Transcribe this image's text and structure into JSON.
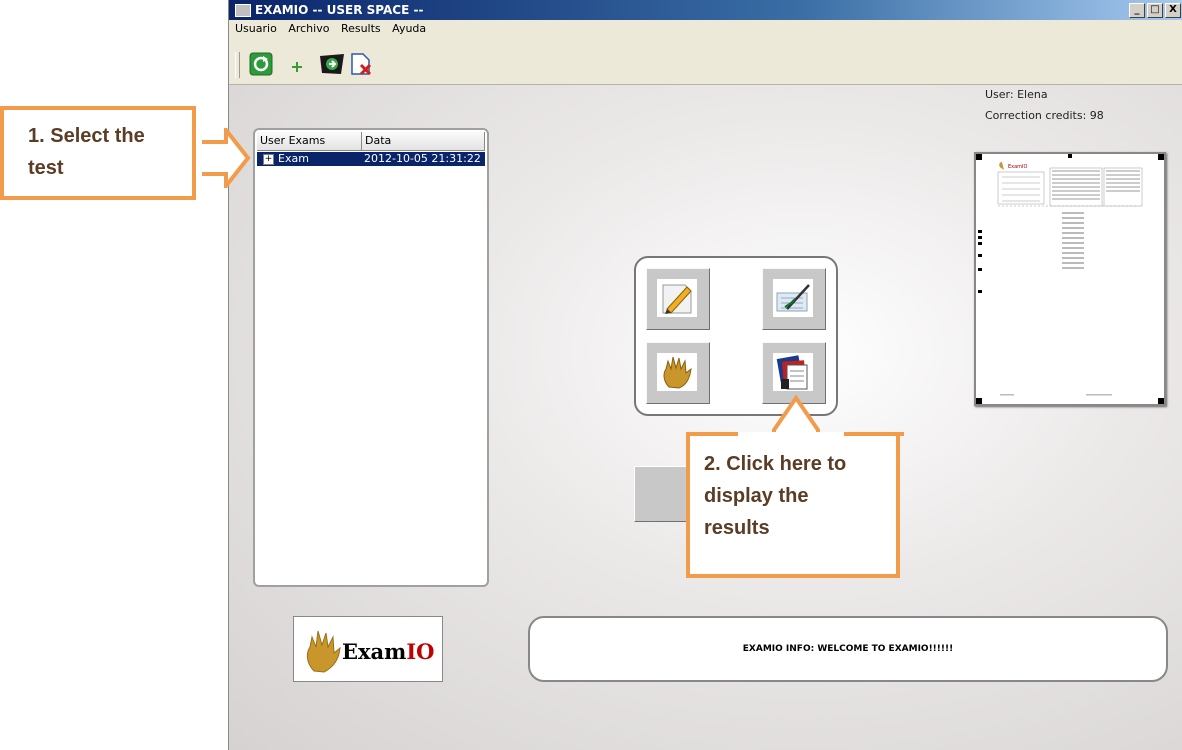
{
  "window": {
    "title": "EXAMIO -- USER SPACE --",
    "controls": [
      "_",
      "□",
      "X"
    ]
  },
  "menu": [
    "Usuario",
    "Archivo",
    "Results",
    "Ayuda"
  ],
  "toolbar": {
    "icons": [
      "refresh-icon",
      "add-icon",
      "load-icon",
      "delete-icon"
    ]
  },
  "user": {
    "name_line": "User: Elena",
    "credits_line": "Correction credits: 98"
  },
  "exams_table": {
    "columns": [
      "User Exams",
      "Data"
    ],
    "rows": [
      {
        "expander": "+",
        "name": "Exam",
        "date": "2012-10-05 21:31:22",
        "selected": true
      }
    ]
  },
  "actions": [
    "edit-exam-icon",
    "correct-exam-icon",
    "hand-icon",
    "results-icon"
  ],
  "logo": {
    "word_start": "Exam",
    "word_end": "IO"
  },
  "status": {
    "text": "EXAMIO INFO: WELCOME TO EXAMIO!!!!!!"
  },
  "annotations": {
    "step1": {
      "line1": "1. Select the",
      "line2": "test"
    },
    "step2": {
      "line1": "2. Click here to",
      "line2": "display the",
      "line3": "results"
    }
  },
  "colors": {
    "callout_border": "#f29b4a",
    "callout_text": "#5a3d24",
    "selection": "#0a246a"
  }
}
